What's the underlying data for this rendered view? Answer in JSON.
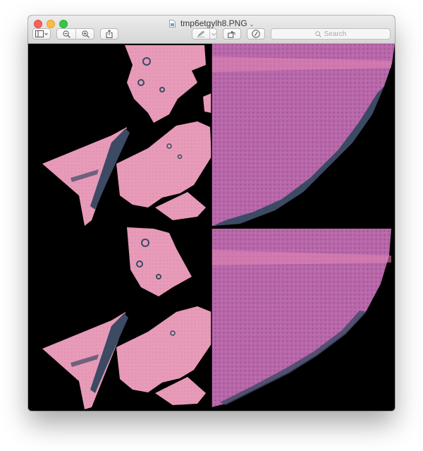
{
  "window": {
    "title": "tmp6etgylh8.PNG",
    "title_chevron": "⌄"
  },
  "toolbar": {
    "icons": [
      "sidebar-icon",
      "chevron-down-icon",
      "zoom-out-icon",
      "zoom-in-icon",
      "share-icon",
      "markup-pen-icon",
      "chevron-down-icon",
      "rotate-icon",
      "annotate-icon",
      "search-icon"
    ],
    "search_placeholder": "Search"
  },
  "image": {
    "description_colors": {
      "background": "#000000",
      "tissue_light": "#e59ab5",
      "tissue_dark": "#b56aa8",
      "stain_blue": "#3c4a63"
    }
  }
}
